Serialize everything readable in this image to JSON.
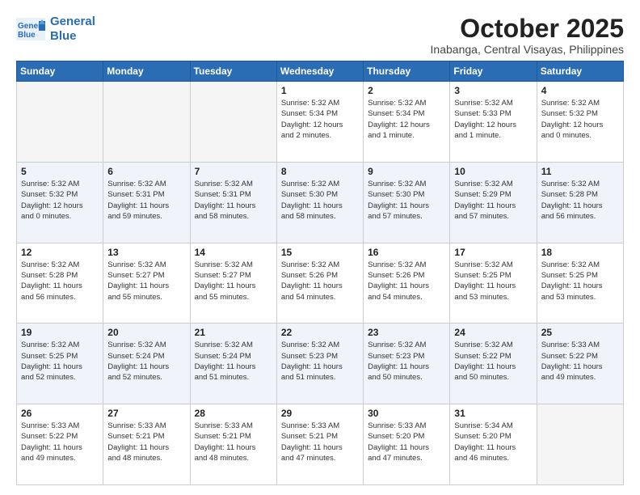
{
  "logo": {
    "line1": "General",
    "line2": "Blue"
  },
  "title": "October 2025",
  "location": "Inabanga, Central Visayas, Philippines",
  "weekdays": [
    "Sunday",
    "Monday",
    "Tuesday",
    "Wednesday",
    "Thursday",
    "Friday",
    "Saturday"
  ],
  "weeks": [
    [
      {
        "day": "",
        "info": ""
      },
      {
        "day": "",
        "info": ""
      },
      {
        "day": "",
        "info": ""
      },
      {
        "day": "1",
        "info": "Sunrise: 5:32 AM\nSunset: 5:34 PM\nDaylight: 12 hours\nand 2 minutes."
      },
      {
        "day": "2",
        "info": "Sunrise: 5:32 AM\nSunset: 5:34 PM\nDaylight: 12 hours\nand 1 minute."
      },
      {
        "day": "3",
        "info": "Sunrise: 5:32 AM\nSunset: 5:33 PM\nDaylight: 12 hours\nand 1 minute."
      },
      {
        "day": "4",
        "info": "Sunrise: 5:32 AM\nSunset: 5:32 PM\nDaylight: 12 hours\nand 0 minutes."
      }
    ],
    [
      {
        "day": "5",
        "info": "Sunrise: 5:32 AM\nSunset: 5:32 PM\nDaylight: 12 hours\nand 0 minutes."
      },
      {
        "day": "6",
        "info": "Sunrise: 5:32 AM\nSunset: 5:31 PM\nDaylight: 11 hours\nand 59 minutes."
      },
      {
        "day": "7",
        "info": "Sunrise: 5:32 AM\nSunset: 5:31 PM\nDaylight: 11 hours\nand 58 minutes."
      },
      {
        "day": "8",
        "info": "Sunrise: 5:32 AM\nSunset: 5:30 PM\nDaylight: 11 hours\nand 58 minutes."
      },
      {
        "day": "9",
        "info": "Sunrise: 5:32 AM\nSunset: 5:30 PM\nDaylight: 11 hours\nand 57 minutes."
      },
      {
        "day": "10",
        "info": "Sunrise: 5:32 AM\nSunset: 5:29 PM\nDaylight: 11 hours\nand 57 minutes."
      },
      {
        "day": "11",
        "info": "Sunrise: 5:32 AM\nSunset: 5:28 PM\nDaylight: 11 hours\nand 56 minutes."
      }
    ],
    [
      {
        "day": "12",
        "info": "Sunrise: 5:32 AM\nSunset: 5:28 PM\nDaylight: 11 hours\nand 56 minutes."
      },
      {
        "day": "13",
        "info": "Sunrise: 5:32 AM\nSunset: 5:27 PM\nDaylight: 11 hours\nand 55 minutes."
      },
      {
        "day": "14",
        "info": "Sunrise: 5:32 AM\nSunset: 5:27 PM\nDaylight: 11 hours\nand 55 minutes."
      },
      {
        "day": "15",
        "info": "Sunrise: 5:32 AM\nSunset: 5:26 PM\nDaylight: 11 hours\nand 54 minutes."
      },
      {
        "day": "16",
        "info": "Sunrise: 5:32 AM\nSunset: 5:26 PM\nDaylight: 11 hours\nand 54 minutes."
      },
      {
        "day": "17",
        "info": "Sunrise: 5:32 AM\nSunset: 5:25 PM\nDaylight: 11 hours\nand 53 minutes."
      },
      {
        "day": "18",
        "info": "Sunrise: 5:32 AM\nSunset: 5:25 PM\nDaylight: 11 hours\nand 53 minutes."
      }
    ],
    [
      {
        "day": "19",
        "info": "Sunrise: 5:32 AM\nSunset: 5:25 PM\nDaylight: 11 hours\nand 52 minutes."
      },
      {
        "day": "20",
        "info": "Sunrise: 5:32 AM\nSunset: 5:24 PM\nDaylight: 11 hours\nand 52 minutes."
      },
      {
        "day": "21",
        "info": "Sunrise: 5:32 AM\nSunset: 5:24 PM\nDaylight: 11 hours\nand 51 minutes."
      },
      {
        "day": "22",
        "info": "Sunrise: 5:32 AM\nSunset: 5:23 PM\nDaylight: 11 hours\nand 51 minutes."
      },
      {
        "day": "23",
        "info": "Sunrise: 5:32 AM\nSunset: 5:23 PM\nDaylight: 11 hours\nand 50 minutes."
      },
      {
        "day": "24",
        "info": "Sunrise: 5:32 AM\nSunset: 5:22 PM\nDaylight: 11 hours\nand 50 minutes."
      },
      {
        "day": "25",
        "info": "Sunrise: 5:33 AM\nSunset: 5:22 PM\nDaylight: 11 hours\nand 49 minutes."
      }
    ],
    [
      {
        "day": "26",
        "info": "Sunrise: 5:33 AM\nSunset: 5:22 PM\nDaylight: 11 hours\nand 49 minutes."
      },
      {
        "day": "27",
        "info": "Sunrise: 5:33 AM\nSunset: 5:21 PM\nDaylight: 11 hours\nand 48 minutes."
      },
      {
        "day": "28",
        "info": "Sunrise: 5:33 AM\nSunset: 5:21 PM\nDaylight: 11 hours\nand 48 minutes."
      },
      {
        "day": "29",
        "info": "Sunrise: 5:33 AM\nSunset: 5:21 PM\nDaylight: 11 hours\nand 47 minutes."
      },
      {
        "day": "30",
        "info": "Sunrise: 5:33 AM\nSunset: 5:20 PM\nDaylight: 11 hours\nand 47 minutes."
      },
      {
        "day": "31",
        "info": "Sunrise: 5:34 AM\nSunset: 5:20 PM\nDaylight: 11 hours\nand 46 minutes."
      },
      {
        "day": "",
        "info": ""
      }
    ]
  ]
}
